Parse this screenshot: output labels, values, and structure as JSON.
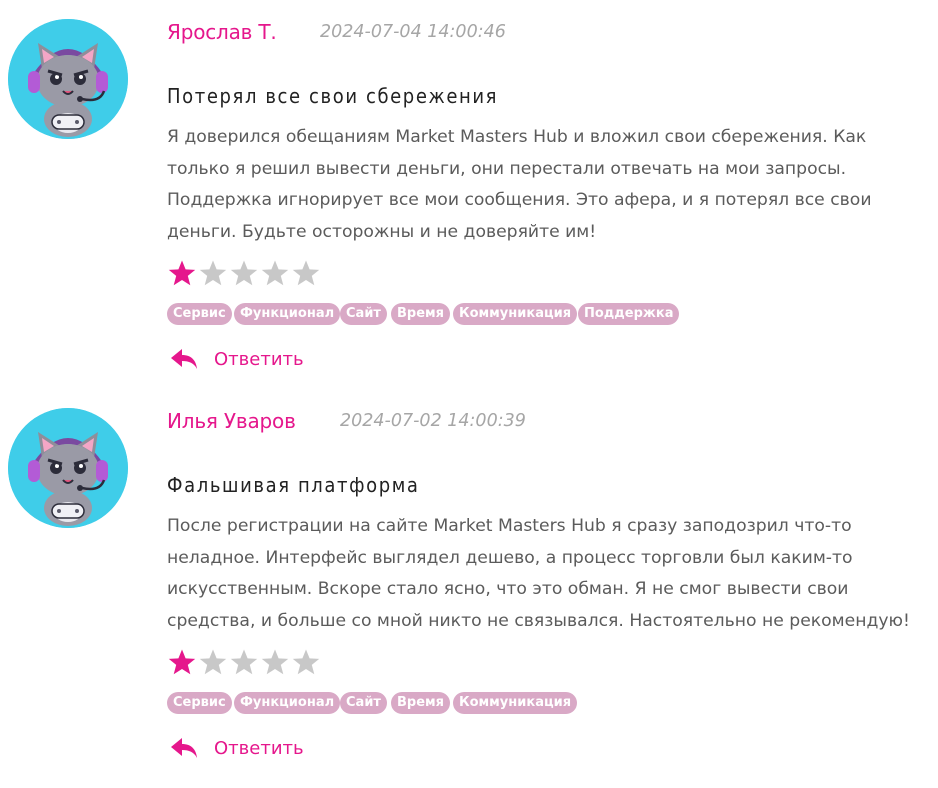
{
  "colors": {
    "accent": "#e5178c",
    "tag_bg": "#d9a9c6",
    "star_empty": "#c8c8c8",
    "avatar_bg": "#3fcde9"
  },
  "reviews": [
    {
      "author": "Ярослав Т.",
      "date": "2024-07-04 14:00:46",
      "title": "Потерял все свои сбережения",
      "lines": [
        "Я доверился обещаниям Market Masters Hub и вложил свои сбережения. Как",
        "только я решил вывести деньги, они перестали отвечать на мои запросы.",
        "Поддержка игнорирует все мои сообщения. Это афера, и я потерял все свои",
        "деньги. Будьте осторожны и не доверяйте им!"
      ],
      "rating": 1,
      "rating_max": 5,
      "tags": [
        "Сервис",
        "Функционал",
        "Сайт",
        "Время",
        "Коммуникация",
        "Поддержка"
      ],
      "reply_label": "Ответить"
    },
    {
      "author": "Илья Уваров",
      "date": "2024-07-02 14:00:39",
      "title": "Фальшивая платформа",
      "lines": [
        "После регистрации на сайте Market Masters Hub я сразу заподозрил что-то",
        "неладное. Интерфейс выглядел дешево, а процесс торговли был каким-то",
        "искусственным. Вскоре стало ясно, что это обман. Я не смог вывести свои",
        "средства, и больше со мной никто не связывался. Настоятельно не рекомендую!"
      ],
      "rating": 1,
      "rating_max": 5,
      "tags": [
        "Сервис",
        "Функционал",
        "Сайт",
        "Время",
        "Коммуникация"
      ],
      "reply_label": "Ответить"
    }
  ]
}
